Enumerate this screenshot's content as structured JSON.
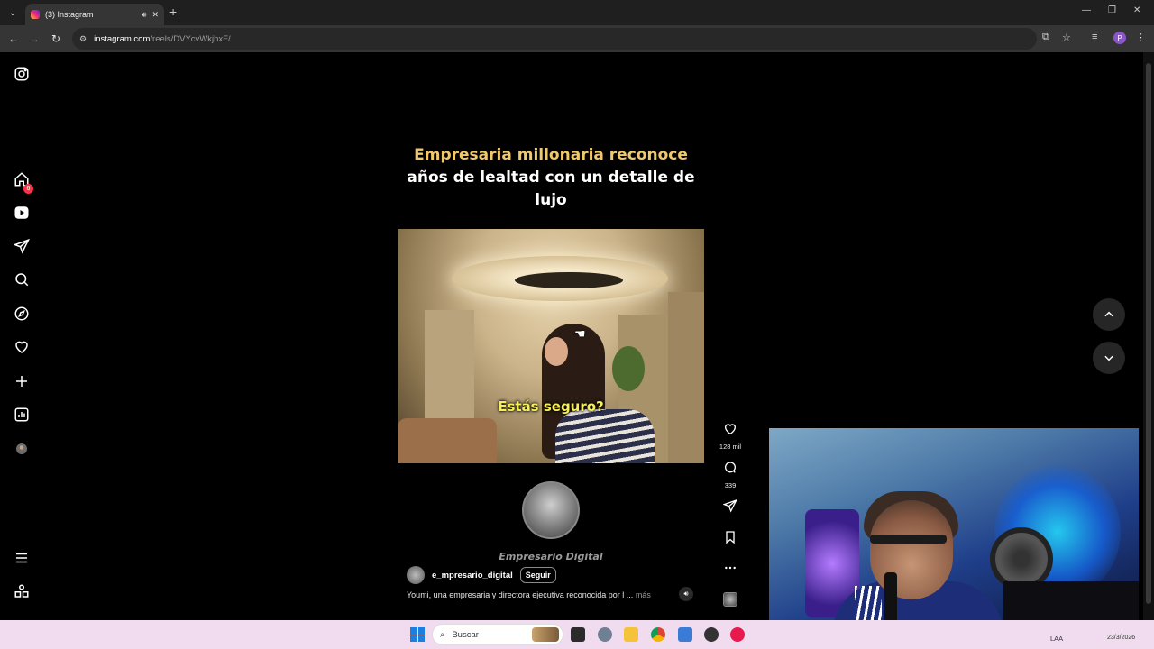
{
  "browser": {
    "tab_title": "(3) Instagram",
    "new_tab_glyph": "+",
    "url_host": "instagram.com",
    "url_path": "/reels/DVYcvWkjhxF/",
    "profile_initial": "P",
    "window_controls": [
      "—",
      "❐",
      "✕"
    ]
  },
  "sidebar": {
    "notification_badge": "6",
    "items": [
      "instagram-logo",
      "home",
      "reels",
      "messages",
      "search",
      "explore",
      "notifications",
      "create",
      "dashboard",
      "profile",
      "more",
      "also-from-meta"
    ]
  },
  "reel": {
    "caption_line1": "Empresaria millonaria reconoce",
    "caption_line2": "años de lealtad con un detalle de",
    "caption_line3": "lujo",
    "subtitle": "Estás seguro?",
    "brand_name": "Empresario Digital",
    "author": "e_mpresario_digital",
    "follow_label": "Seguir",
    "description": "Youmi, una empresaria y directora ejecutiva reconocida por l ...",
    "more_label": "más"
  },
  "actions": {
    "likes": "128 mil",
    "comments": "339"
  },
  "taskbar": {
    "search_placeholder": "Buscar",
    "tray_text": "LAA",
    "date": "23/3/2026"
  },
  "colors": {
    "caption_highlight": "#f0c96a",
    "subtitle": "#f7ef5a",
    "badge": "#ff3040",
    "taskbar": "#f1dcef"
  }
}
